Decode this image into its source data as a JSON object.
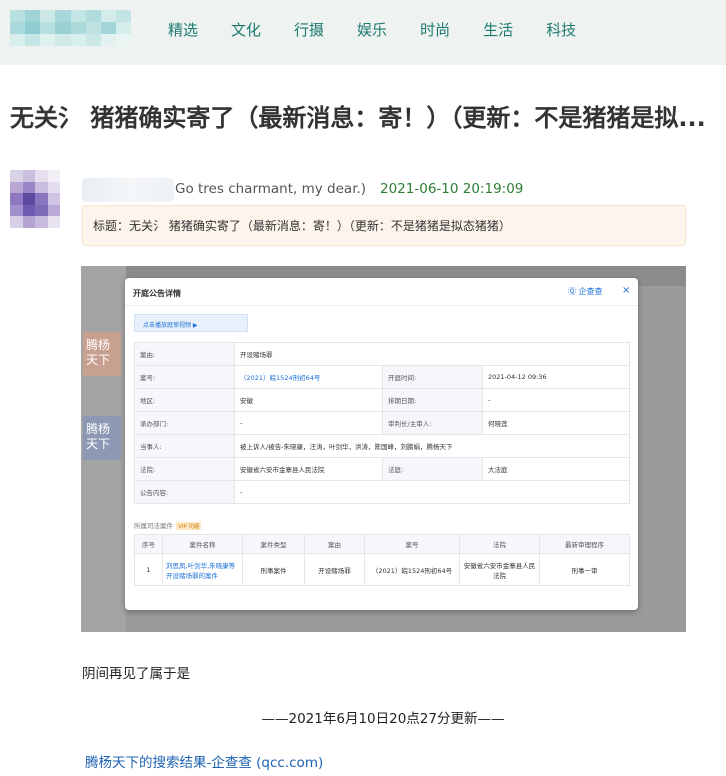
{
  "nav": {
    "items": [
      "精选",
      "文化",
      "行摄",
      "娱乐",
      "时尚",
      "生活",
      "科技"
    ]
  },
  "post": {
    "title": "无关氵 猪猪确实寄了（最新消息：寄！）（更新：不是猪猪是拟...",
    "author": "Go tres charmant, my dear.)",
    "time": "2021-06-10 20:19:09",
    "notice": "标题：无关氵 猪猪确实寄了（最新消息：寄！）（更新：不是猪猪是拟态猪猪）",
    "paragraph": "阴间再见了属于是",
    "update_line": "——2021年6月10日20点27分更新——",
    "reference_link": "腾杨天下的搜索结果-企查查 (qcc.com)"
  },
  "screenshot": {
    "side_tag1": "腾杨天下",
    "side_tag2": "腾杨天下",
    "dialog_title": "开庭公告详情",
    "brand": "企查查",
    "close": "×",
    "video_button": "点击播放庭审视频  ▶",
    "rows": [
      {
        "k1": "案由:",
        "v1": "开设赌场罪",
        "k2": "",
        "v2": ""
      },
      {
        "k1": "案号:",
        "v1": "（2021）皖1524刑初64号",
        "k2": "开庭时间:",
        "v2": "2021-04-12 09:36"
      },
      {
        "k1": "地区:",
        "v1": "安徽",
        "k2": "排期日期:",
        "v2": "-"
      },
      {
        "k1": "承办部门:",
        "v1": "-",
        "k2": "审判长/主审人:",
        "v2": "何晓莲"
      },
      {
        "k1": "当事人:",
        "v1": "被上诉人/被告-朱晓康，汪涛，叶剑华，洪涛，陈国峰，刘鹏娟，腾杨天下",
        "k2": "",
        "v2": ""
      },
      {
        "k1": "法院:",
        "v1": "安徽省六安市金寨县人民法院",
        "k2": "法庭:",
        "v2": "大法庭"
      },
      {
        "k1": "公告内容:",
        "v1": "-",
        "k2": "",
        "v2": ""
      }
    ],
    "related_label": "所属司法案件",
    "vip_label": "VIP 功能",
    "related_headers": [
      "序号",
      "案件名称",
      "案件类型",
      "案由",
      "案号",
      "法院",
      "最新审理程序"
    ],
    "related_row": [
      "1",
      "刘思凤,叶剑华,朱晓康等开设赌场罪的案件",
      "刑事案件",
      "开设赌场罪",
      "（2021）皖1524刑初64号",
      "安徽省六安市金寨县人民法院",
      "刑事一审"
    ]
  },
  "colors": {
    "nav_text": "#1e7a6e",
    "time_text": "#2e7d32",
    "link": "#1e62b3",
    "notice_bg": "#fdf5ec",
    "topbar_bg": "#eef3f1"
  }
}
